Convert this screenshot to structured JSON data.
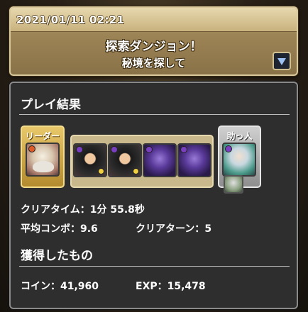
{
  "header": {
    "datetime": "2021/01/11 02:21",
    "title": "探索ダンジョン！",
    "subtitle": "秘境を探して"
  },
  "result": {
    "section_title": "プレイ結果",
    "leader_label": "リーダー",
    "helper_label": "助っ人",
    "team": [
      {
        "name": "leader-monster",
        "icon": "white-haired-girl-portrait"
      },
      {
        "name": "sub-monster-1",
        "icon": "dark-haired-warrior-portrait"
      },
      {
        "name": "sub-monster-2",
        "icon": "dark-haired-warrior-portrait"
      },
      {
        "name": "sub-monster-3",
        "icon": "purple-dragon-portrait"
      },
      {
        "name": "sub-monster-4",
        "icon": "purple-dragon-portrait"
      },
      {
        "name": "helper-monster",
        "icon": "silver-haired-girl-portrait"
      }
    ],
    "clear_time_label": "クリアタイム：",
    "clear_time_value": "1分 55.8秒",
    "avg_combo_label": "平均コンボ：",
    "avg_combo_value": "9.6",
    "clear_turns_label": "クリアターン：",
    "clear_turns_value": "5"
  },
  "rewards": {
    "section_title": "獲得したもの",
    "coin_label": "コイン：",
    "coin_value": "41,960",
    "exp_label": "EXP：",
    "exp_value": "15,478"
  },
  "colors": {
    "accent_gold": "#e8c86a",
    "panel_bg": "#2e2e2e",
    "dark_attribute": "#7a3fc0",
    "fire_attribute": "#e05a28",
    "light_attribute": "#f0d040"
  }
}
